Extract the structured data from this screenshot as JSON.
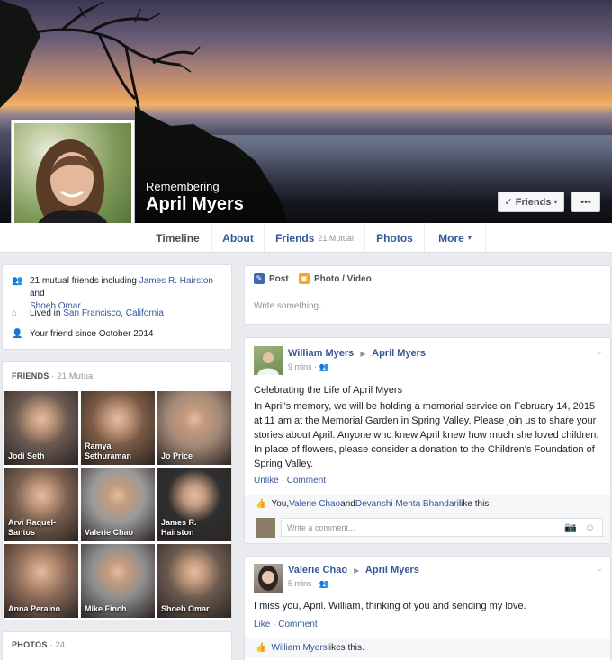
{
  "profile": {
    "remembering_label": "Remembering",
    "name": "April Myers",
    "friends_button": "Friends",
    "more_button": "•••"
  },
  "tabs": [
    {
      "label": "Timeline"
    },
    {
      "label": "About"
    },
    {
      "label": "Friends",
      "sub": "21 Mutual"
    },
    {
      "label": "Photos"
    },
    {
      "label": "More"
    }
  ],
  "intro": {
    "mutual_prefix": "21 mutual friends including ",
    "mutual_friend_1": "James R. Hairston",
    "and": " and",
    "mutual_friend_2": "Shoeb Omar",
    "lived_prefix": "Lived in ",
    "lived_city": "San Francisco, California",
    "friend_since": "Your friend since October 2014"
  },
  "friends_section": {
    "title": "FRIENDS",
    "count": " · 21 Mutual",
    "friends": [
      {
        "name": "Jodi Seth",
        "color": "#6b5a52"
      },
      {
        "name": "Ramya Sethuraman",
        "color": "#7a5a45"
      },
      {
        "name": "Jo Price",
        "color": "#a48a78"
      },
      {
        "name": "Arvi Raquel-Santos",
        "color": "#7a6050"
      },
      {
        "name": "Valerie Chao",
        "color": "#9a9a9a"
      },
      {
        "name": "James R. Hairston",
        "color": "#2f2f2f"
      },
      {
        "name": "Anna Peraino",
        "color": "#8a6a58"
      },
      {
        "name": "Mike Finch",
        "color": "#8f8f8f"
      },
      {
        "name": "Shoeb Omar",
        "color": "#6a5a4e"
      }
    ]
  },
  "photos_section": {
    "title": "PHOTOS",
    "count": " · 24"
  },
  "composer": {
    "post_tab": "Post",
    "photo_tab": "Photo / Video",
    "placeholder": "Write something..."
  },
  "post1": {
    "author": "William Myers",
    "target": "April Myers",
    "time": "9 mins · ",
    "title": "Celebrating the Life of April Myers",
    "body": "In April's memory, we will be holding a memorial service on February 14, 2015 at 11 am at the Memorial Garden in Spring Valley. Please join us to share your stories about April. Anyone who knew April knew how much she loved children. In place of flowers, please consider a donation to the Children's Foundation of Spring Valley.",
    "unlike": "Unlike",
    "comment": "Comment",
    "likes_prefix": "You, ",
    "liker_1": "Valerie Chao",
    "likes_and": " and ",
    "liker_2": "Devanshi Mehta Bhandari",
    "likes_suffix": " like this.",
    "comment_placeholder": "Write a comment..."
  },
  "post2": {
    "author": "Valerie Chao",
    "target": "April Myers",
    "time": "5 mins · ",
    "body": "I miss you, April. William, thinking of you and sending my love.",
    "like": "Like",
    "comment": "Comment",
    "liker": "William Myers",
    "likes_suffix": " likes this."
  },
  "colors": {
    "link": "#365899",
    "background": "#e9ebee"
  }
}
